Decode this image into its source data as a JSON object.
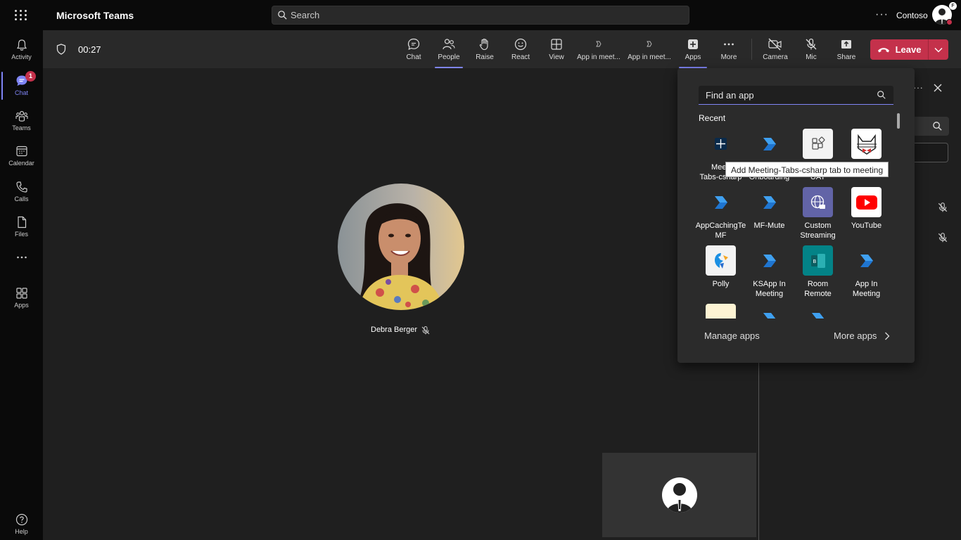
{
  "app": {
    "title": "Microsoft Teams"
  },
  "search": {
    "placeholder": "Search"
  },
  "account": {
    "org": "Contoso",
    "badge": "F"
  },
  "rail": {
    "items": [
      {
        "label": "Activity",
        "icon": "bell-icon"
      },
      {
        "label": "Chat",
        "icon": "chat-icon",
        "badge": "1",
        "active": true
      },
      {
        "label": "Teams",
        "icon": "teams-icon"
      },
      {
        "label": "Calendar",
        "icon": "calendar-icon"
      },
      {
        "label": "Calls",
        "icon": "phone-icon"
      },
      {
        "label": "Files",
        "icon": "file-icon"
      },
      {
        "label": "",
        "icon": "more-icon"
      },
      {
        "label": "Apps",
        "icon": "apps-icon"
      },
      {
        "label": "Help",
        "icon": "help-icon"
      }
    ]
  },
  "meeting": {
    "timer": "00:27",
    "toolbar": {
      "chat": "Chat",
      "people": "People",
      "raise": "Raise",
      "react": "React",
      "view": "View",
      "app1": "App in meet...",
      "app2": "App in meet...",
      "apps": "Apps",
      "more": "More",
      "camera": "Camera",
      "mic": "Mic",
      "share": "Share",
      "leave": "Leave"
    },
    "participant": {
      "name": "Debra Berger",
      "muted": true
    }
  },
  "apps_flyout": {
    "search_placeholder": "Find an app",
    "recent_label": "Recent",
    "apps": [
      {
        "name": "Meeting-Tabs-csharp",
        "icon": "plus-icon",
        "line1": "Meeti",
        "line2": "Tabs-csharp"
      },
      {
        "name": "Onboarding",
        "icon": "power-automate-icon",
        "line1": "",
        "line2": "Onboarding"
      },
      {
        "name": "UAT",
        "icon": "shapes-icon",
        "line1": "",
        "line2": "UAT"
      },
      {
        "name": "Cat app",
        "icon": "cat-icon",
        "line1": "",
        "line2": ""
      },
      {
        "name": "AppCachingTeMF",
        "icon": "power-automate-icon",
        "line1": "AppCachingTe",
        "line2": "MF"
      },
      {
        "name": "MF-Mute",
        "icon": "power-automate-icon",
        "line1": "MF-Mute",
        "line2": ""
      },
      {
        "name": "Custom Streaming",
        "icon": "globe-video-icon",
        "line1": "Custom",
        "line2": "Streaming"
      },
      {
        "name": "YouTube",
        "icon": "youtube-icon",
        "line1": "YouTube",
        "line2": ""
      },
      {
        "name": "Polly",
        "icon": "polly-icon",
        "line1": "Polly",
        "line2": ""
      },
      {
        "name": "KSApp In Meeting",
        "icon": "power-automate-icon",
        "line1": "KSApp In",
        "line2": "Meeting"
      },
      {
        "name": "Room Remote",
        "icon": "room-remote-icon",
        "line1": "Room",
        "line2": "Remote"
      },
      {
        "name": "App In Meeting",
        "icon": "power-automate-icon",
        "line1": "App In",
        "line2": "Meeting"
      }
    ],
    "manage_label": "Manage apps",
    "more_label": "More apps",
    "tooltip": "Add Meeting-Tabs-csharp tab to meeting"
  },
  "colors": {
    "accent": "#7f85f5",
    "leave": "#c4314b",
    "toolbar_bg": "#292929",
    "stage_bg": "#1f1f1f"
  }
}
